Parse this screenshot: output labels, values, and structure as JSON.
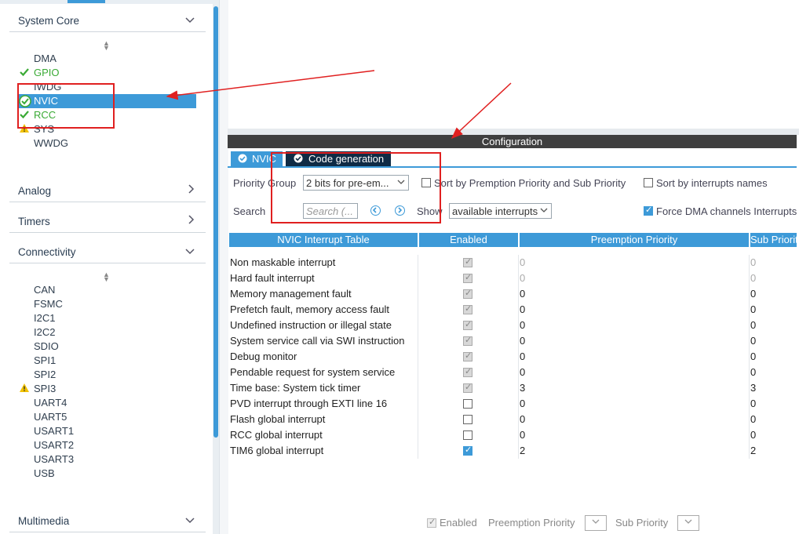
{
  "sidebar": {
    "system_core": {
      "title": "System Core",
      "items": [
        {
          "label": "DMA",
          "status": "none"
        },
        {
          "label": "GPIO",
          "status": "ok"
        },
        {
          "label": "IWDG",
          "status": "none"
        },
        {
          "label": "NVIC",
          "status": "selected"
        },
        {
          "label": "RCC",
          "status": "ok"
        },
        {
          "label": "SYS",
          "status": "warning"
        },
        {
          "label": "WWDG",
          "status": "none"
        }
      ]
    },
    "analog": {
      "title": "Analog"
    },
    "timers": {
      "title": "Timers"
    },
    "connectivity": {
      "title": "Connectivity",
      "items": [
        {
          "label": "CAN",
          "status": "none"
        },
        {
          "label": "FSMC",
          "status": "none"
        },
        {
          "label": "I2C1",
          "status": "none"
        },
        {
          "label": "I2C2",
          "status": "none"
        },
        {
          "label": "SDIO",
          "status": "none"
        },
        {
          "label": "SPI1",
          "status": "none"
        },
        {
          "label": "SPI2",
          "status": "none"
        },
        {
          "label": "SPI3",
          "status": "warning"
        },
        {
          "label": "UART4",
          "status": "none"
        },
        {
          "label": "UART5",
          "status": "none"
        },
        {
          "label": "USART1",
          "status": "none"
        },
        {
          "label": "USART2",
          "status": "none"
        },
        {
          "label": "USART3",
          "status": "none"
        },
        {
          "label": "USB",
          "status": "none"
        }
      ]
    },
    "multimedia": {
      "title": "Multimedia"
    }
  },
  "config": {
    "title": "Configuration",
    "tabs": [
      {
        "label": "NVIC"
      },
      {
        "label": "Code generation"
      }
    ],
    "priority_group_label": "Priority Group",
    "priority_group_value": "2 bits for pre-em...",
    "sort_premption_label": "Sort by Premption Priority and Sub Priority",
    "sort_names_label": "Sort by interrupts names",
    "search_label": "Search",
    "search_placeholder": "Search (...",
    "show_label": "Show",
    "show_value": "available interrupts",
    "force_dma_label": "Force DMA channels Interrupts",
    "columns": [
      "NVIC Interrupt Table",
      "Enabled",
      "Preemption Priority",
      "Sub Priority"
    ],
    "rows": [
      {
        "name": "Non maskable interrupt",
        "enabled": "locked",
        "pre": "0",
        "sub": "0",
        "dim": true
      },
      {
        "name": "Hard fault interrupt",
        "enabled": "locked",
        "pre": "0",
        "sub": "0",
        "dim": true
      },
      {
        "name": "Memory management fault",
        "enabled": "locked",
        "pre": "0",
        "sub": "0",
        "dim": false
      },
      {
        "name": "Prefetch fault, memory access fault",
        "enabled": "locked",
        "pre": "0",
        "sub": "0",
        "dim": false
      },
      {
        "name": "Undefined instruction or illegal state",
        "enabled": "locked",
        "pre": "0",
        "sub": "0",
        "dim": false
      },
      {
        "name": "System service call via SWI instruction",
        "enabled": "locked",
        "pre": "0",
        "sub": "0",
        "dim": false
      },
      {
        "name": "Debug monitor",
        "enabled": "locked",
        "pre": "0",
        "sub": "0",
        "dim": false
      },
      {
        "name": "Pendable request for system service",
        "enabled": "locked",
        "pre": "0",
        "sub": "0",
        "dim": false
      },
      {
        "name": "Time base: System tick timer",
        "enabled": "locked",
        "pre": "3",
        "sub": "3",
        "dim": false
      },
      {
        "name": "PVD interrupt through EXTI line 16",
        "enabled": "off",
        "pre": "0",
        "sub": "0",
        "dim": false
      },
      {
        "name": "Flash global interrupt",
        "enabled": "off",
        "pre": "0",
        "sub": "0",
        "dim": false
      },
      {
        "name": "RCC global interrupt",
        "enabled": "off",
        "pre": "0",
        "sub": "0",
        "dim": false
      },
      {
        "name": "TIM6 global interrupt",
        "enabled": "on",
        "pre": "2",
        "sub": "2",
        "dim": false
      }
    ],
    "bottom": {
      "enabled_label": "Enabled",
      "preemption_label": "Preemption Priority",
      "sub_label": "Sub Priority"
    }
  },
  "colors": {
    "accent": "#3d9ad8",
    "ok": "#3aaa35",
    "warning": "#f2c200",
    "annotation": "#e02020"
  }
}
